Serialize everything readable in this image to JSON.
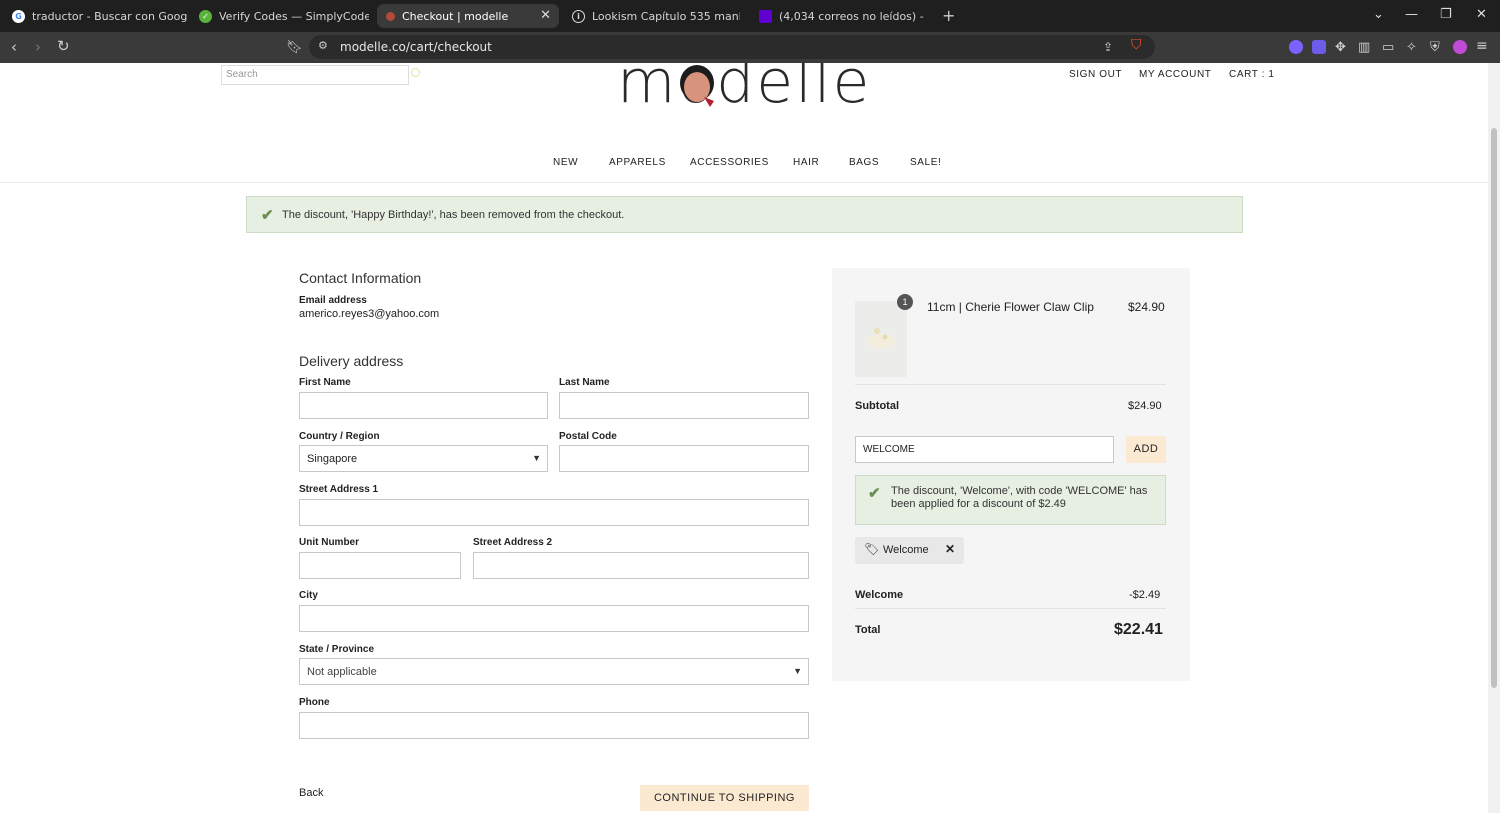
{
  "browser": {
    "tabs": [
      {
        "title": "traductor - Buscar con Google",
        "favicon": "google-icon",
        "color": "#ffffff"
      },
      {
        "title": "Verify Codes — SimplyCodes",
        "favicon": "simplycodes-icon",
        "color": "#59b33b"
      },
      {
        "title": "Checkout | modelle",
        "favicon": "modelle-icon",
        "color": "#b24a3a"
      },
      {
        "title": "Lookism Capítulo 535 manhwa | Ma",
        "favicon": "info-icon",
        "color": "#ffffff"
      },
      {
        "title": "(4,034 correos no leídos) - americo.",
        "favicon": "yahoo-mail-icon",
        "color": "#6001d2"
      }
    ],
    "url": "modelle.co/cart/checkout"
  },
  "header": {
    "search_placeholder": "Search",
    "logo_text": "modelle",
    "sign_out": "SIGN OUT",
    "my_account": "MY ACCOUNT",
    "cart": "CART : 1"
  },
  "nav": {
    "items": [
      "NEW",
      "APPARELS",
      "ACCESSORIES",
      "HAIR",
      "BAGS",
      "SALE!"
    ]
  },
  "notice": {
    "message": "The discount, 'Happy Birthday!', has been removed from the checkout."
  },
  "contact": {
    "heading": "Contact Information",
    "email_label": "Email address",
    "email": "americo.reyes3@yahoo.com"
  },
  "delivery": {
    "heading": "Delivery address",
    "first_name_label": "First Name",
    "last_name_label": "Last Name",
    "country_label": "Country / Region",
    "country_value": "Singapore",
    "postal_label": "Postal Code",
    "street1_label": "Street Address 1",
    "unit_label": "Unit Number",
    "street2_label": "Street Address 2",
    "city_label": "City",
    "state_label": "State / Province",
    "state_value": "Not applicable",
    "phone_label": "Phone"
  },
  "actions": {
    "back": "Back",
    "continue": "CONTINUE TO SHIPPING"
  },
  "summary": {
    "item": {
      "qty": "1",
      "name": "11cm | Cherie Flower Claw Clip",
      "price": "$24.90"
    },
    "subtotal_label": "Subtotal",
    "subtotal_value": "$24.90",
    "code_value": "WELCOME",
    "add_label": "ADD",
    "discount_notice": "The discount, 'Welcome', with code 'WELCOME' has been applied for a discount of $2.49",
    "chip_label": "Welcome",
    "discount_label": "Welcome",
    "discount_value": "-$2.49",
    "total_label": "Total",
    "total_value": "$22.41"
  }
}
